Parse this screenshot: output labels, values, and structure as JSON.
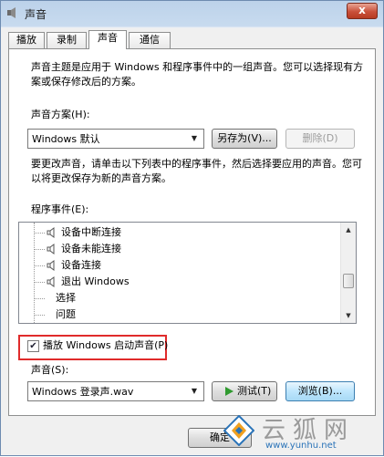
{
  "window": {
    "title": "声音",
    "close_label": "x"
  },
  "tabs": [
    {
      "label": "播放"
    },
    {
      "label": "录制"
    },
    {
      "label": "声音"
    },
    {
      "label": "通信"
    }
  ],
  "description": {
    "line1": "声音主题是应用于 Windows 和程序事件中的一组声音。您可以选择现有方",
    "line2": "案或保存修改后的方案。"
  },
  "scheme": {
    "label": "声音方案(H):",
    "value": "Windows 默认",
    "save_as_label": "另存为(V)...",
    "delete_label": "删除(D)"
  },
  "instruction": {
    "line1": "要更改声音，请单击以下列表中的程序事件，然后选择要应用的声音。您可",
    "line2": "以将更改保存为新的声音方案。"
  },
  "events": {
    "label": "程序事件(E):",
    "items": [
      {
        "label": "设备中断连接",
        "icon": "speaker-icon"
      },
      {
        "label": "设备未能连接",
        "icon": "speaker-icon"
      },
      {
        "label": "设备连接",
        "icon": "speaker-icon"
      },
      {
        "label": "退出 Windows",
        "icon": "speaker-icon"
      },
      {
        "label": "选择",
        "icon": ""
      },
      {
        "label": "问题",
        "icon": ""
      }
    ]
  },
  "startup_sound": {
    "label": "播放 Windows 启动声音(P)",
    "checked": true,
    "check_mark": "✔"
  },
  "sound": {
    "label": "声音(S):",
    "value": "Windows 登录声.wav",
    "test_label": "测试(T)",
    "browse_label": "浏览(B)..."
  },
  "footer": {
    "ok_label": "确定"
  },
  "watermark": {
    "brand_text": "云狐网",
    "url": "www.yunhu.net"
  },
  "colors": {
    "highlight_border": "#e02b2b",
    "test_arrow": "#2f9a2f"
  }
}
